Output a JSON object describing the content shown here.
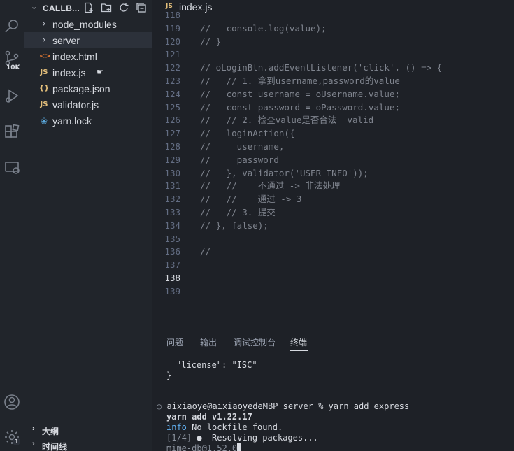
{
  "sidebar": {
    "title": "CALLB...",
    "files": [
      {
        "icon": "chevron-right",
        "name": "node_modules"
      },
      {
        "icon": "chevron-right",
        "name": "server"
      },
      {
        "icon": "html",
        "name": "index.html"
      },
      {
        "icon": "JS",
        "name": "index.js"
      },
      {
        "icon": "{}",
        "name": "package.json"
      },
      {
        "icon": "JS",
        "name": "validator.js"
      },
      {
        "icon": "yarn",
        "name": "yarn.lock"
      }
    ],
    "outline_label": "大纲",
    "timeline_label": "时间线"
  },
  "activity": {
    "scm_badge": "10K",
    "settings_badge": "1"
  },
  "editor": {
    "tab_icon": "JS",
    "tab_name": "index.js",
    "current_line": "138",
    "lines": [
      {
        "n": "118",
        "code": ""
      },
      {
        "n": "119",
        "code": "//   console.log(value);"
      },
      {
        "n": "120",
        "code": "// }"
      },
      {
        "n": "121",
        "code": ""
      },
      {
        "n": "122",
        "code": "// oLoginBtn.addEventListener('click', () => {"
      },
      {
        "n": "123",
        "code": "//   // 1. 拿到username,password的value"
      },
      {
        "n": "124",
        "code": "//   const username = oUsername.value;"
      },
      {
        "n": "125",
        "code": "//   const password = oPassword.value;"
      },
      {
        "n": "126",
        "code": "//   // 2. 检查value是否合法  valid"
      },
      {
        "n": "127",
        "code": "//   loginAction({"
      },
      {
        "n": "128",
        "code": "//     username,"
      },
      {
        "n": "129",
        "code": "//     password"
      },
      {
        "n": "130",
        "code": "//   }, validator('USER_INFO'));"
      },
      {
        "n": "131",
        "code": "//   //    不通过 -> 非法处理"
      },
      {
        "n": "132",
        "code": "//   //    通过 -> 3"
      },
      {
        "n": "133",
        "code": "//   // 3. 提交"
      },
      {
        "n": "134",
        "code": "// }, false);"
      },
      {
        "n": "135",
        "code": ""
      },
      {
        "n": "136",
        "code": "// ------------------------"
      },
      {
        "n": "137",
        "code": ""
      },
      {
        "n": "138",
        "code": ""
      },
      {
        "n": "139",
        "code": ""
      }
    ]
  },
  "panel": {
    "tabs": [
      "问题",
      "输出",
      "调试控制台",
      "终端"
    ],
    "active_tab": "终端",
    "terminal": {
      "license_line": "\"license\": \"ISC\"",
      "close_brace": "}",
      "prompt_marker": "○",
      "prompt": "aixiaoye@aixiaoyedeMBP server % yarn add express",
      "yarn_version": "yarn add v1.22.17",
      "info_label": "info",
      "info_text": "No lockfile found.",
      "step": "[1/4]",
      "step_text": "Resolving packages...",
      "package_line": "mime-db@1.52.0"
    }
  }
}
